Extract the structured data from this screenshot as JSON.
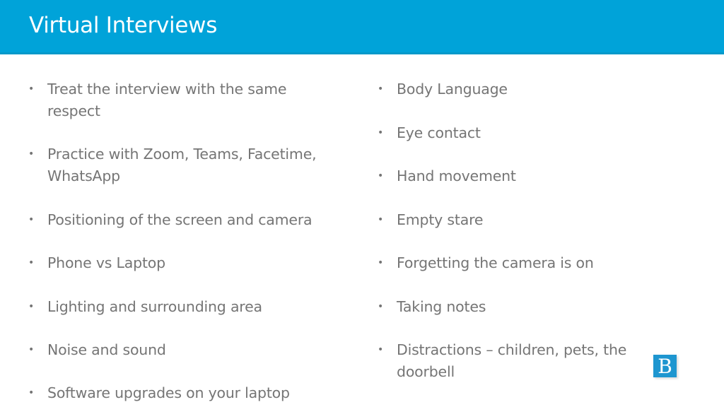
{
  "slide": {
    "title": "Virtual Interviews",
    "left_column": [
      {
        "line1": "Treat the interview with the same",
        "line2": "respect"
      },
      {
        "line1": "Practice with Zoom, Teams, Facetime,",
        "line2": "WhatsApp"
      },
      {
        "line1": "Positioning of the screen and camera"
      },
      {
        "line1": "Phone vs Laptop"
      },
      {
        "line1": "Lighting and surrounding area"
      },
      {
        "line1": "Noise and sound"
      },
      {
        "line1": "Software upgrades on your laptop"
      }
    ],
    "right_column": [
      {
        "line1": "Body Language"
      },
      {
        "line1": "Eye contact"
      },
      {
        "line1": "Hand movement"
      },
      {
        "line1": "Empty stare"
      },
      {
        "line1": "Forgetting the camera is on"
      },
      {
        "line1": "Taking notes"
      },
      {
        "line1": "Distractions – children, pets, the",
        "line2": "doorbell"
      }
    ],
    "bullet_glyph": "•",
    "logo_letter": "B",
    "colors": {
      "header": "#00a3d9",
      "text": "#757575",
      "logo": "#1e96d0"
    }
  }
}
